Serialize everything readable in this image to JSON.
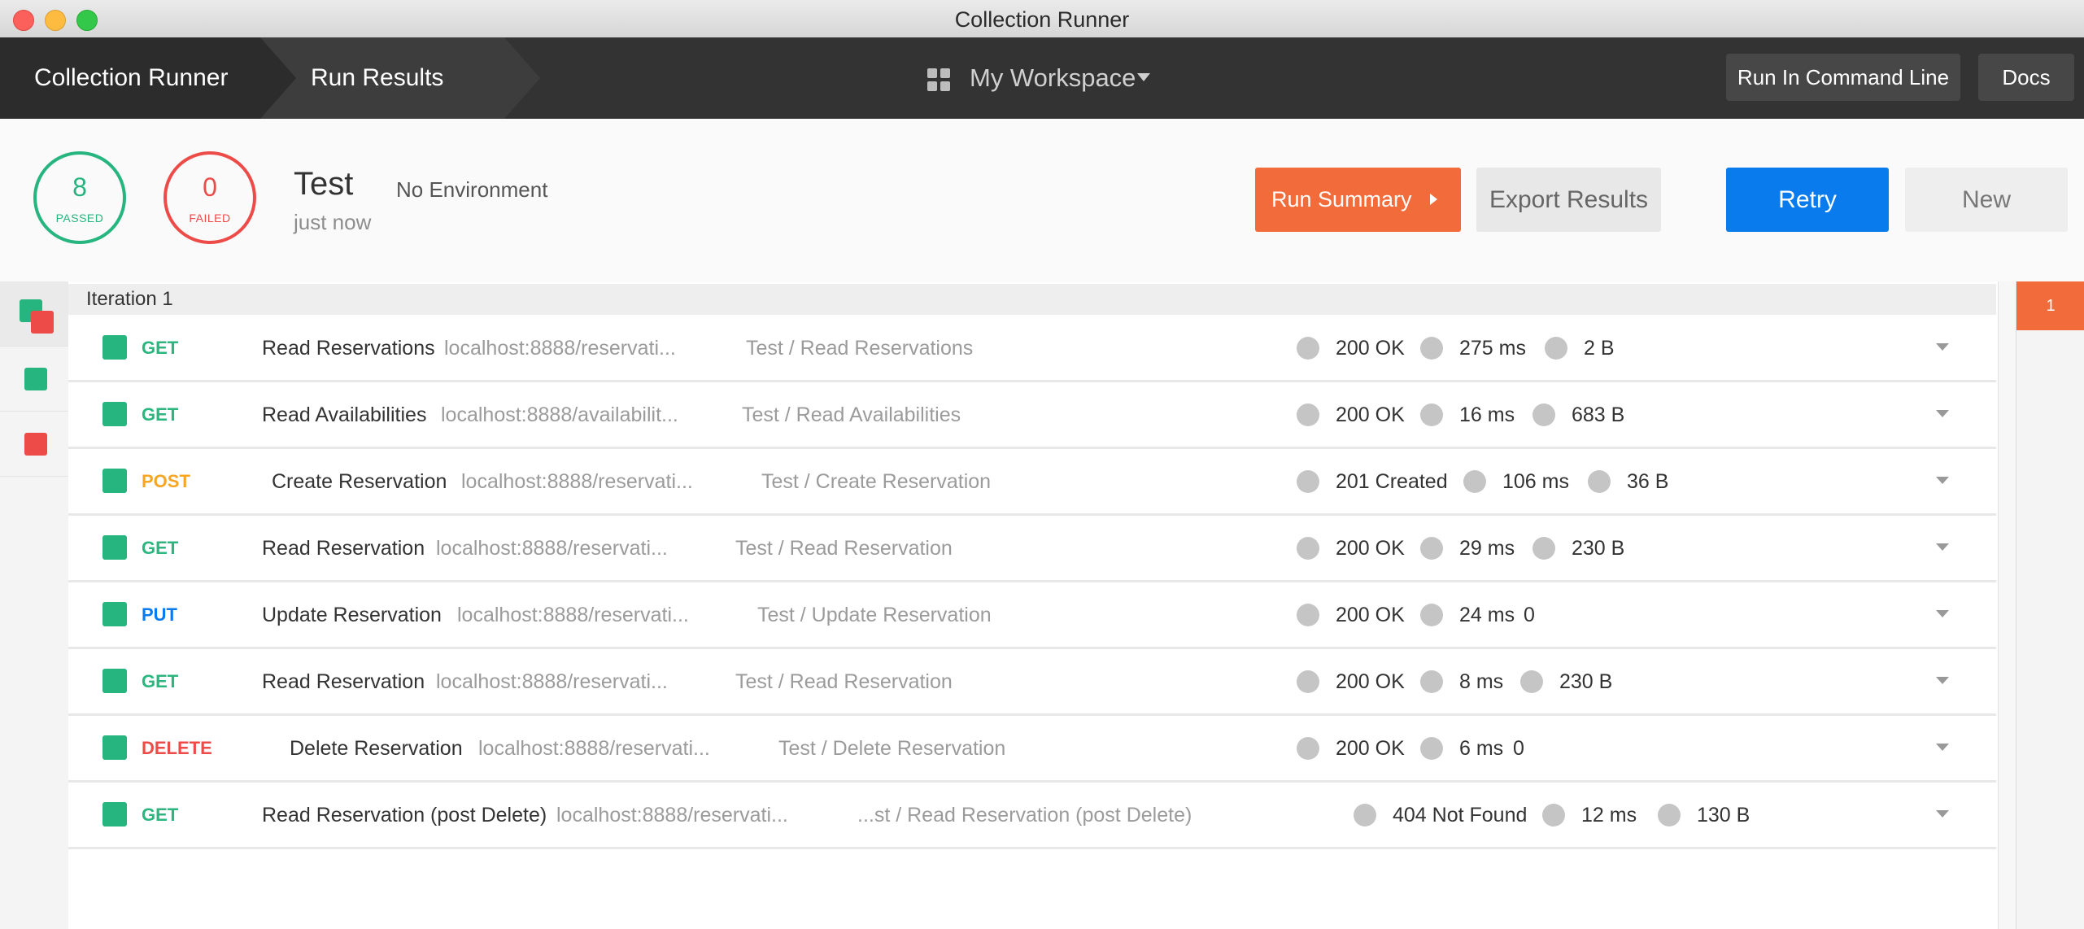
{
  "window": {
    "title": "Collection Runner"
  },
  "header": {
    "breadcrumb": [
      "Collection Runner",
      "Run Results"
    ],
    "workspace": "My Workspace",
    "run_cli_label": "Run In Command Line",
    "docs_label": "Docs"
  },
  "summary": {
    "passed_count": "8",
    "passed_label": "PASSED",
    "failed_count": "0",
    "failed_label": "FAILED",
    "run_name": "Test",
    "environment": "No Environment",
    "time": "just now",
    "run_summary_label": "Run Summary",
    "export_label": "Export Results",
    "retry_label": "Retry",
    "new_label": "New"
  },
  "iteration": {
    "label": "Iteration 1",
    "tab": "1"
  },
  "requests": [
    {
      "method": "GET",
      "name": "Read Reservations",
      "url": "localhost:8888/reservati...",
      "path": "Test / Read Reservations",
      "status": "200 OK",
      "time": "275 ms",
      "size": "2 B"
    },
    {
      "method": "GET",
      "name": "Read Availabilities",
      "url": "localhost:8888/availabilit...",
      "path": "Test / Read Availabilities",
      "status": "200 OK",
      "time": "16 ms",
      "size": "683 B"
    },
    {
      "method": "POST",
      "name": "Create Reservation",
      "url": "localhost:8888/reservati...",
      "path": "Test / Create Reservation",
      "status": "201 Created",
      "time": "106 ms",
      "size": "36 B"
    },
    {
      "method": "GET",
      "name": "Read Reservation",
      "url": "localhost:8888/reservati...",
      "path": "Test / Read Reservation",
      "status": "200 OK",
      "time": "29 ms",
      "size": "230 B"
    },
    {
      "method": "PUT",
      "name": "Update Reservation",
      "url": "localhost:8888/reservati...",
      "path": "Test / Update Reservation",
      "status": "200 OK",
      "time": "24 ms",
      "size": "0"
    },
    {
      "method": "GET",
      "name": "Read Reservation",
      "url": "localhost:8888/reservati...",
      "path": "Test / Read Reservation",
      "status": "200 OK",
      "time": "8 ms",
      "size": "230 B"
    },
    {
      "method": "DELETE",
      "name": "Delete Reservation",
      "url": "localhost:8888/reservati...",
      "path": "Test / Delete Reservation",
      "status": "200 OK",
      "time": "6 ms",
      "size": "0"
    },
    {
      "method": "GET",
      "name": "Read Reservation (post Delete)",
      "url": "localhost:8888/reservati...",
      "path": "...st / Read Reservation (post Delete)",
      "status": "404 Not Found",
      "time": "12 ms",
      "size": "130 B"
    }
  ],
  "colors": {
    "passed": "#26b47f",
    "failed": "#ed4b48",
    "accent_orange": "#f26b3a",
    "retry_blue": "#097bed",
    "header_dark": "#333333"
  },
  "icons": {
    "workspace": "grid-icon",
    "workspace_dropdown": "chevron-down-icon",
    "run_summary": "caret-right-icon",
    "row_expand": "chevron-down-icon"
  }
}
